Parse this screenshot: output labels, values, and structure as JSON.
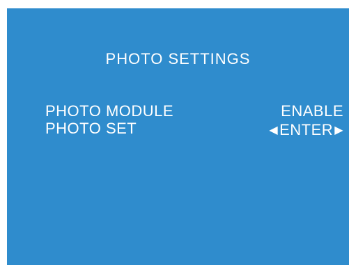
{
  "osd": {
    "title": "PHOTO SETTINGS",
    "background_color": "#2f8ccd",
    "text_color": "#ffffff",
    "items": [
      {
        "label": "PHOTO MODULE",
        "value": "ENABLE"
      },
      {
        "label": "PHOTO SET",
        "value": "ENTER",
        "left_icon": "left-triangle-icon",
        "right_icon": "right-triangle-icon"
      }
    ]
  }
}
